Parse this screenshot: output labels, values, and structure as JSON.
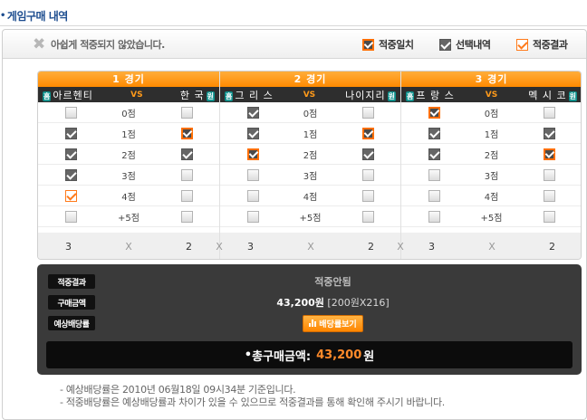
{
  "page": {
    "title": "게임구매 내역"
  },
  "header": {
    "result_message": "아쉽게 적중되지 않았습니다.",
    "legend": [
      {
        "label": "적중일치",
        "style": "hit"
      },
      {
        "label": "선택내역",
        "style": "checked"
      },
      {
        "label": "적중결과",
        "style": "result"
      }
    ]
  },
  "games": [
    {
      "title": "1 경기",
      "home": "아르헨티",
      "home_tag": "홈",
      "vs": "VS",
      "away": "한 국",
      "away_tag": "원",
      "rows": [
        {
          "label": "0점",
          "home": "none",
          "away": "none"
        },
        {
          "label": "1점",
          "home": "checked",
          "away": "hit"
        },
        {
          "label": "2점",
          "home": "checked",
          "away": "checked"
        },
        {
          "label": "3점",
          "home": "checked",
          "away": "none"
        },
        {
          "label": "4점",
          "home": "result",
          "away": "none"
        },
        {
          "label": "+5점",
          "home": "none",
          "away": "none"
        }
      ],
      "score_home": "3",
      "score_sep": "X",
      "score_away": "2"
    },
    {
      "title": "2 경기",
      "home": "그 리 스",
      "home_tag": "홈",
      "vs": "VS",
      "away": "나이지리",
      "away_tag": "원",
      "rows": [
        {
          "label": "0점",
          "home": "checked",
          "away": "none"
        },
        {
          "label": "1점",
          "home": "checked",
          "away": "hit"
        },
        {
          "label": "2점",
          "home": "hit",
          "away": "checked"
        },
        {
          "label": "3점",
          "home": "none",
          "away": "none"
        },
        {
          "label": "4점",
          "home": "none",
          "away": "none"
        },
        {
          "label": "+5점",
          "home": "none",
          "away": "none"
        }
      ],
      "score_home": "3",
      "score_sep": "X",
      "score_away": "2"
    },
    {
      "title": "3 경기",
      "home": "프 랑 스",
      "home_tag": "홈",
      "vs": "VS",
      "away": "멕 시 코",
      "away_tag": "원",
      "rows": [
        {
          "label": "0점",
          "home": "hit",
          "away": "none"
        },
        {
          "label": "1점",
          "home": "checked",
          "away": "checked"
        },
        {
          "label": "2점",
          "home": "checked",
          "away": "hit"
        },
        {
          "label": "3점",
          "home": "none",
          "away": "none"
        },
        {
          "label": "4점",
          "home": "none",
          "away": "none"
        },
        {
          "label": "+5점",
          "home": "none",
          "away": "none"
        }
      ],
      "score_home": "3",
      "score_sep": "X",
      "score_away": "2"
    }
  ],
  "between_sep": "X",
  "summary": {
    "result_label": "적중결과",
    "result_value": "적중안됨",
    "purchase_label": "구매금액",
    "purchase_amount": "43,200원",
    "purchase_detail": "[200원X216]",
    "odds_label": "예상배당률",
    "odds_button": "배당률보기",
    "total_label": "총구매금액:",
    "total_amount": "43,200",
    "total_unit": "원"
  },
  "notes": [
    "- 예상배당률은 2010년 06월18일 09시34분 기준입니다.",
    "- 적중배당률은 예상배당률과 차이가 있을 수 있으므로 적중결과를 통해 확인해 주시기 바랍니다."
  ],
  "colors": {
    "accent": "#ff8a00",
    "title_blue": "#1d4d8f",
    "dark_panel": "#3a3a3a",
    "hit_border": "#ff6e00"
  }
}
